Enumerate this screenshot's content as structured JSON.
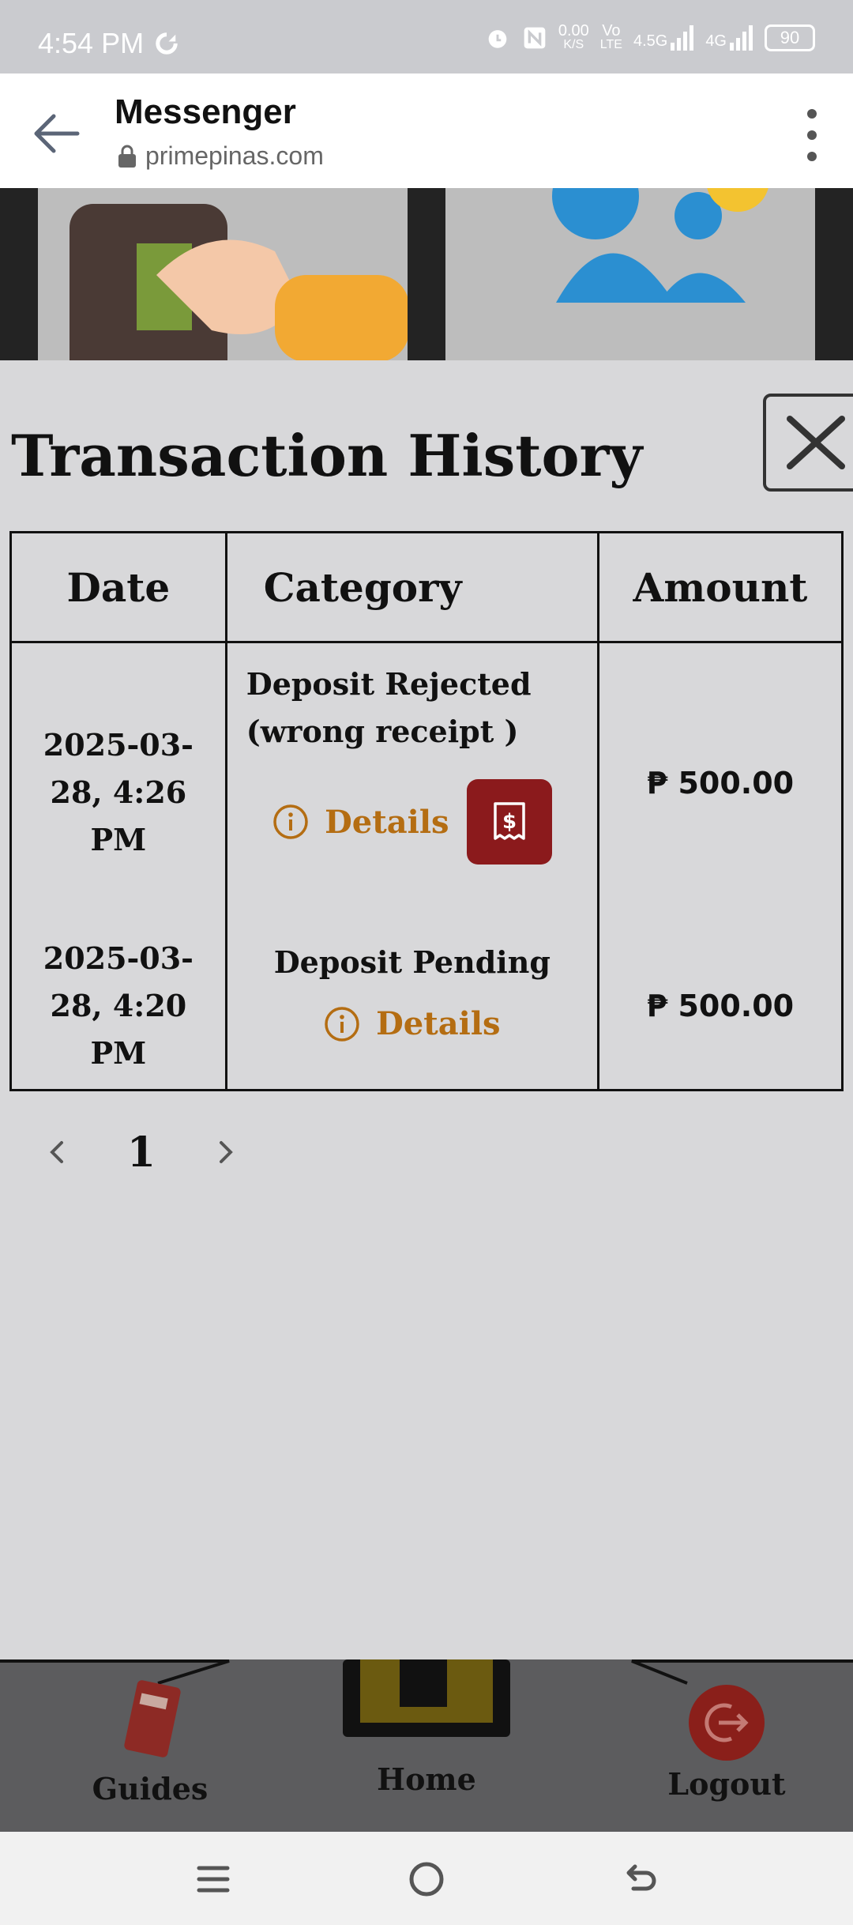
{
  "status": {
    "time": "4:54 PM",
    "net_speed": "0.00",
    "net_unit": "K/S",
    "volte_top": "Vo",
    "volte_bottom": "LTE",
    "sig1": "4.5G",
    "sig2": "4G",
    "battery": "90"
  },
  "browser": {
    "title": "Messenger",
    "url": "primepinas.com"
  },
  "modal": {
    "title": "Transaction History",
    "columns": [
      "Date",
      "Category",
      "Amount"
    ],
    "rows": [
      {
        "date": "2025-03-28, 4:26 PM",
        "category": "Deposit Rejected (wrong receipt )",
        "details": "Details",
        "amount": "₱ 500.00"
      },
      {
        "date": "2025-03-28, 4:20 PM",
        "category": "Deposit Pending",
        "details": "Details",
        "amount": "₱ 500.00"
      }
    ],
    "page": "1"
  },
  "bottom_nav": {
    "guides": "Guides",
    "home": "Home",
    "logout": "Logout"
  },
  "colors": {
    "details": "#b46d12",
    "receipt_button": "#8b1a1c"
  }
}
